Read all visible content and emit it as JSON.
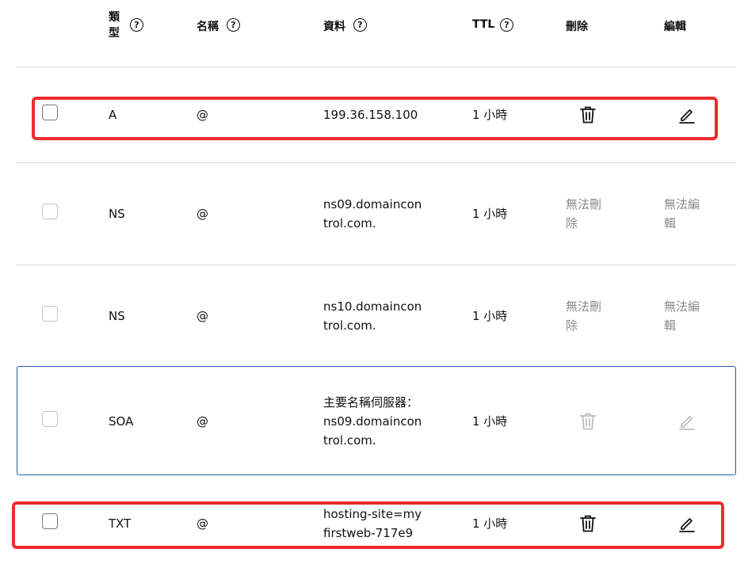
{
  "header": {
    "type_label": "類型",
    "name_label": "名稱",
    "data_label": "資料",
    "ttl_label": "TTL",
    "delete_label": "刪除",
    "edit_label": "編輯",
    "help_glyph": "?"
  },
  "rows": [
    {
      "type": "A",
      "name": "@",
      "data": "199.36.158.100",
      "ttl": "1 小時",
      "delete": "trash-icon",
      "edit": "pencil-icon",
      "can_delete": true,
      "can_edit": true,
      "highlight": "red"
    },
    {
      "type": "NS",
      "name": "@",
      "data": "ns09.domaincontrol.com.",
      "ttl": "1 小時",
      "delete_text": "無法刪除",
      "edit_text": "無法編輯",
      "can_delete": false,
      "can_edit": false
    },
    {
      "type": "NS",
      "name": "@",
      "data": "ns10.domaincontrol.com.",
      "ttl": "1 小時",
      "delete_text": "無法刪除",
      "edit_text": "無法編輯",
      "can_delete": false,
      "can_edit": false
    },
    {
      "type": "SOA",
      "name": "@",
      "data": "主要名稱伺服器：ns09.domaincontrol.com.",
      "ttl": "1 小時",
      "delete": "trash-icon",
      "edit": "pencil-icon",
      "can_delete": false,
      "can_edit": false,
      "highlight": "blue"
    },
    {
      "type": "TXT",
      "name": "@",
      "data": "hosting-site=myfirstweb-717e9",
      "ttl": "1 小時",
      "delete": "trash-icon",
      "edit": "pencil-icon",
      "can_delete": true,
      "can_edit": true,
      "highlight": "red"
    }
  ],
  "colors": {
    "highlight_red": "#ef2b2d",
    "highlight_blue": "#1f5fa6",
    "muted": "#8a8a8a"
  }
}
